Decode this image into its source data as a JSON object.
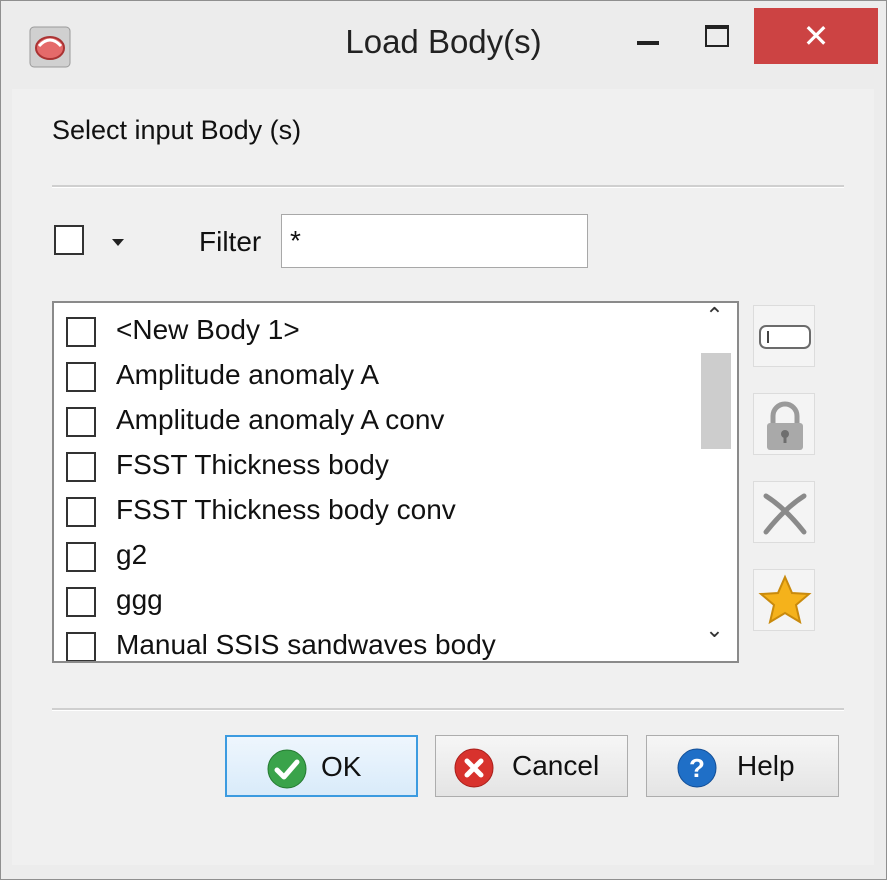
{
  "window": {
    "title": "Load Body(s)",
    "close_glyph": "✕",
    "icons": {
      "app": "app-logo-icon",
      "minimize": "minimize-icon",
      "maximize": "maximize-icon",
      "close": "close-icon"
    }
  },
  "dialog": {
    "instruction": "Select input Body (s)",
    "filter": {
      "label": "Filter",
      "value": "*"
    },
    "items": [
      {
        "label": "<New Body 1>",
        "checked": false
      },
      {
        "label": "Amplitude anomaly A",
        "checked": false
      },
      {
        "label": "Amplitude anomaly A conv",
        "checked": false
      },
      {
        "label": "FSST Thickness body",
        "checked": false
      },
      {
        "label": "FSST Thickness body conv",
        "checked": false
      },
      {
        "label": "g2",
        "checked": false
      },
      {
        "label": "ggg",
        "checked": false
      },
      {
        "label": "Manual SSIS sandwaves body",
        "checked": false
      }
    ],
    "side_buttons": [
      "rename-icon",
      "lock-icon",
      "remove-icon",
      "star-icon"
    ],
    "buttons": {
      "ok": "OK",
      "cancel": "Cancel",
      "help": "Help"
    }
  },
  "colors": {
    "close_button": "#cc4343",
    "ok_border": "#3c9be0",
    "ok_icon": "#3aa34a",
    "cancel_icon": "#d8322d",
    "help_icon": "#1f6fc7",
    "star": "#f5b21b"
  }
}
